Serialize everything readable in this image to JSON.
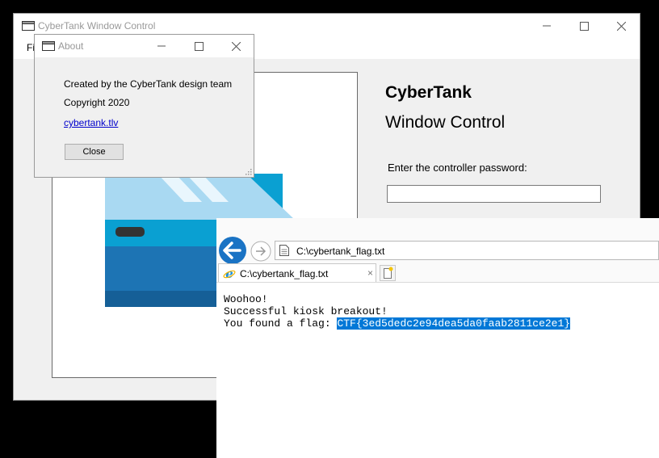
{
  "main_window": {
    "title": "CyberTank Window Control",
    "menu": {
      "file_label": "Fi"
    },
    "heading_line1": "CyberTank",
    "heading_line2": "Window Control",
    "password_label": "Enter the controller password:",
    "password_value": ""
  },
  "about_dialog": {
    "title": "About",
    "created_by": "Created by the CyberTank design team",
    "copyright": "Copyright 2020",
    "link": "cybertank.tlv",
    "close_label": "Close"
  },
  "browser": {
    "address": "C:\\cybertank_flag.txt",
    "tab_title": "C:\\cybertank_flag.txt",
    "tab_close": "×",
    "content": {
      "line1": "Woohoo!",
      "line2": "Successful kiosk breakout!",
      "line3_prefix": "You found a flag: ",
      "flag": "CTF{3ed5dedc2e94dea5da0faab2811ce2e1}"
    }
  },
  "icons": {
    "window_icon": "app-window-icon",
    "minimize": "minimize-icon",
    "maximize": "maximize-icon",
    "close": "close-icon",
    "back": "back-arrow-icon",
    "forward": "forward-arrow-icon",
    "page": "page-icon",
    "ie": "internet-explorer-icon",
    "new_tab": "new-tab-icon",
    "grip": "resize-grip-icon"
  },
  "colors": {
    "selection": "#0078d7",
    "link": "#0000cc",
    "back_button": "#1a73c4",
    "train_blue": "#0aa0d2"
  }
}
